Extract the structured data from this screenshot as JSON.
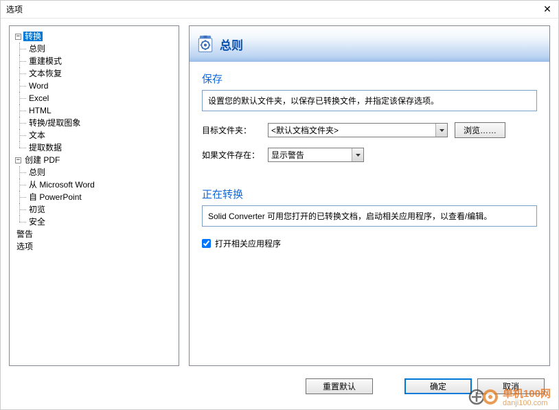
{
  "window": {
    "title": "选项"
  },
  "tree": {
    "root1": {
      "label": "转换",
      "children": [
        "总则",
        "重建模式",
        "文本恢复",
        "Word",
        "Excel",
        "HTML",
        "转换/提取图象",
        "文本",
        "提取数据"
      ]
    },
    "root2": {
      "label": "创建 PDF",
      "children": [
        "总则",
        "从 Microsoft Word",
        "自 PowerPoint",
        "初览",
        "安全"
      ]
    },
    "loose": [
      "警告",
      "选项"
    ]
  },
  "header": {
    "title": "总则"
  },
  "save": {
    "group_title": "保存",
    "desc": "设置您的默认文件夹，以保存已转换文件，并指定该保存选项。",
    "target_label": "目标文件夹：",
    "target_value": "<默认文档文件夹>",
    "browse": "浏览……",
    "exists_label": "如果文件存在：",
    "exists_value": "显示警告"
  },
  "convert": {
    "group_title": "正在转换",
    "desc": "Solid Converter 可用您打开的已转换文档，启动相关应用程序，以查看/编辑。",
    "open_label": "打开相关应用程序"
  },
  "footer": {
    "reset": "重置默认",
    "ok": "确定",
    "cancel": "取消"
  },
  "watermark": {
    "line1": "单机100网",
    "line2": "danji100.com"
  }
}
